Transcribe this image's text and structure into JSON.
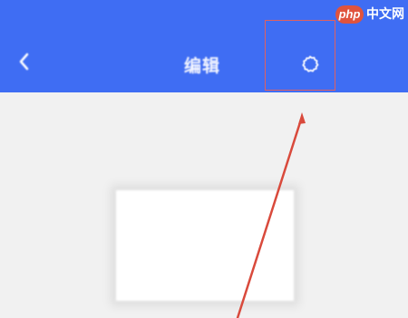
{
  "status_bar": {
    "left_text": "",
    "time": ""
  },
  "nav": {
    "back_icon": "chevron-left-icon",
    "title": "编辑",
    "settings_icon": "gear-icon",
    "right_label": ""
  },
  "watermark": {
    "php": "php",
    "site": "中文网"
  },
  "colors": {
    "nav_background": "#3f6df3",
    "page_background": "#f1f1f1",
    "annotation_red": "#e06060"
  }
}
